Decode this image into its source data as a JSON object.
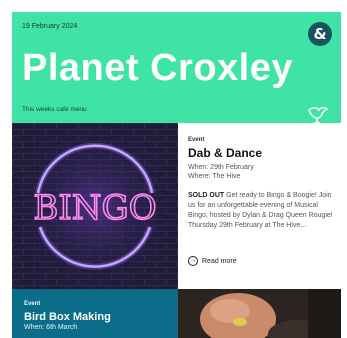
{
  "header": {
    "date": "19 February 2024",
    "title": "Planet Croxley",
    "menu_link": "This weeks café menu",
    "logo_icon": "ampersand-logo-icon",
    "accent_color": "#3fe3a6",
    "badge_color": "#17545e"
  },
  "event1": {
    "eyebrow": "Event",
    "title": "Dab & Dance",
    "when": "When: 29th February",
    "where": "Where: The Hive",
    "sold_out": "SOLD OUT",
    "description": "Get ready to Bingo & Boogie! Join us for an unforgettable evening of Musical Bingo, hosted by Dylan & Drag Queen Rougie! Thursday 29th February at The Hive...",
    "read_more": "Read more",
    "image_text": "BINGO"
  },
  "event2": {
    "eyebrow": "Event",
    "title": "Bird Box Making",
    "when": "When: 6th March",
    "panel_color": "#0b6d8a"
  }
}
